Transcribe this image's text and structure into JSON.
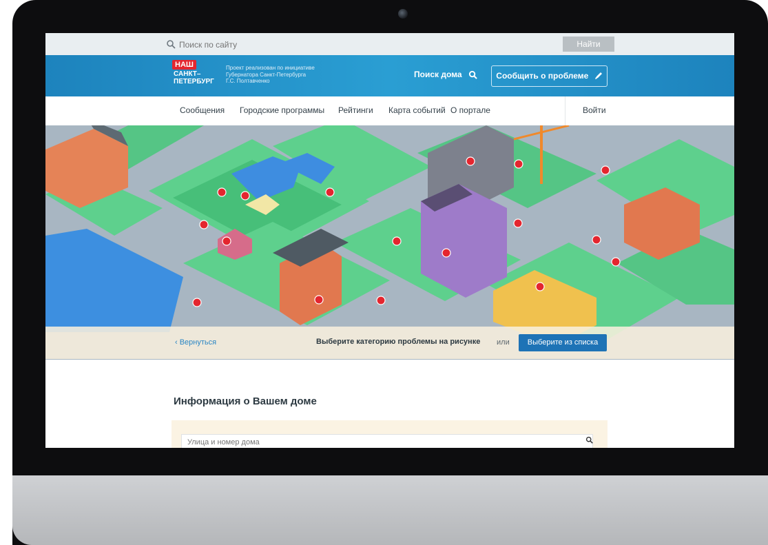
{
  "search": {
    "placeholder": "Поиск по сайту",
    "button": "Найти"
  },
  "header": {
    "logo_line1": "НАШ",
    "logo_line2": "САНКТ–",
    "logo_line3": "ПЕТЕРБУРГ",
    "tagline_1": "Проект реализован по инициативе",
    "tagline_2": "Губернатора Санкт-Петербурга",
    "tagline_3": "Г.С. Полтавченко",
    "house_search": "Поиск дома",
    "report_button": "Сообщить о проблеме"
  },
  "nav": {
    "items": [
      "Сообщения",
      "Городские программы",
      "Рейтинги",
      "Карта событий",
      "О портале"
    ],
    "login": "Войти"
  },
  "category": {
    "back": "‹ Вернуться",
    "prompt": "Выберите категорию проблемы на рисунке",
    "or": "или",
    "list_button": "Выберите из списка"
  },
  "house_info": {
    "title": "Информация о Вашем доме",
    "address_placeholder": "Улица и номер дома"
  },
  "colors": {
    "header_blue": "#2a9ed3",
    "accent_red": "#e4262f",
    "button_blue": "#1e73b6"
  }
}
